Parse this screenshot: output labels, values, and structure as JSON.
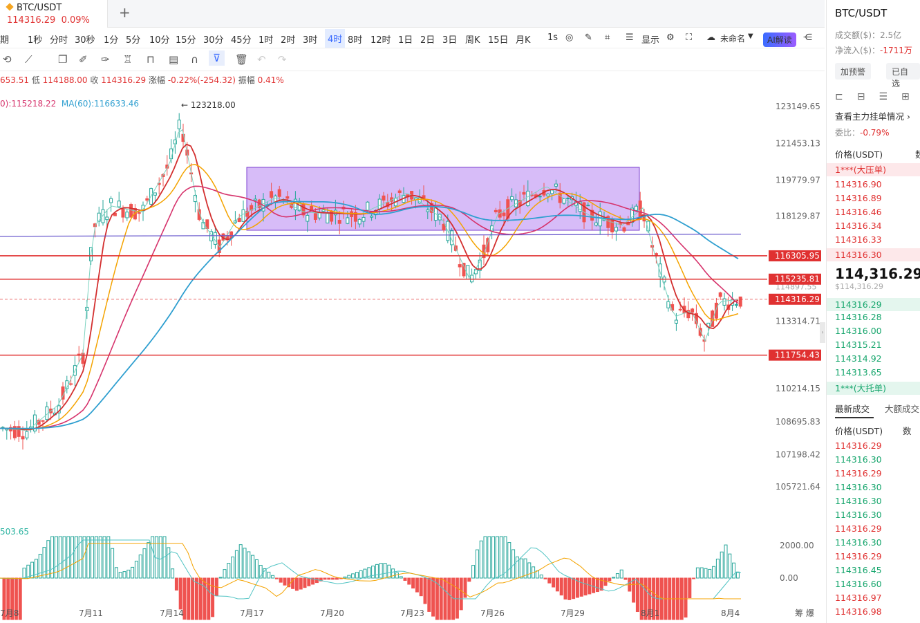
{
  "tab": {
    "symbol": "BTC/USDT",
    "price": "114316.29",
    "change": "0.09%"
  },
  "intervals": [
    "期",
    "1秒",
    "分时",
    "30秒",
    "1分",
    "5分",
    "10分",
    "15分",
    "30分",
    "45分",
    "1时",
    "2时",
    "3时",
    "4时",
    "8时",
    "12时",
    "1日",
    "2日",
    "3日",
    "周K",
    "15日",
    "月K",
    "1s"
  ],
  "active_interval": "4时",
  "toolbar1_extra": {
    "display": "显示",
    "unnamed": "未命名",
    "ai": "AI解读"
  },
  "ohlc": {
    "open": "653.51",
    "low_label": "低",
    "low": "114188.00",
    "close_label": "收",
    "close": "114316.29",
    "chg_label": "涨幅",
    "chg": "-0.22%(-254.32)",
    "amp_label": "振幅",
    "amp": "0.41%"
  },
  "ma": {
    "ma30": "0):115218.22",
    "ma60": "MA(60):116633.46"
  },
  "macd_value": "503.65",
  "high_marker": "123218.00",
  "price_axis": [
    "123149.65",
    "121453.13",
    "119779.97",
    "118129.87",
    "113314.71",
    "110214.15",
    "108695.83",
    "107198.42",
    "105721.64"
  ],
  "level_lines": [
    {
      "value": 116305.95,
      "label": "116305.95"
    },
    {
      "value": 115235.81,
      "label": "115235.81"
    },
    {
      "value": 111754.43,
      "label": "111754.43"
    }
  ],
  "current_label": "114316.29",
  "hidden_label": "114897.55",
  "macd_axis": [
    "2000.00",
    "0.00"
  ],
  "date_axis": [
    "7月8",
    "7月11",
    "7月14",
    "7月17",
    "7月20",
    "7月23",
    "7月26",
    "7月29",
    "8月1",
    "8月4"
  ],
  "bottom_right": "筹 爆",
  "panel": {
    "title": "BTC/USDT",
    "volume": "成交额($)：2.5亿",
    "netflow_label": "净流入($)：",
    "netflow": "-1711万",
    "btn_alert": "加预警",
    "btn_fav": "已自选",
    "orderbook_link": "查看主力挂单情况",
    "ratio_label": "委比：",
    "ratio": "-0.79%",
    "price_header": "价格(USDT)",
    "qty_header": "数",
    "ask_big": "1***(大压单)",
    "asks": [
      "114316.90",
      "114316.89",
      "114316.46",
      "114316.34",
      "114316.33",
      "114316.30"
    ],
    "last": "114,316.29",
    "last_usd": "$114,316.29",
    "bids": [
      "114316.29",
      "114316.28",
      "114316.00",
      "114315.21",
      "114314.92",
      "114313.65"
    ],
    "bid_big": "1***(大托单)",
    "trades_tab": "最新成交",
    "big_trades_tab": "大额成交",
    "trades": [
      {
        "p": "114316.29",
        "c": "red"
      },
      {
        "p": "114316.30",
        "c": "green"
      },
      {
        "p": "114316.29",
        "c": "red"
      },
      {
        "p": "114316.30",
        "c": "green"
      },
      {
        "p": "114316.30",
        "c": "green"
      },
      {
        "p": "114316.30",
        "c": "green"
      },
      {
        "p": "114316.29",
        "c": "red"
      },
      {
        "p": "114316.30",
        "c": "green"
      },
      {
        "p": "114316.29",
        "c": "red"
      },
      {
        "p": "114316.45",
        "c": "green"
      },
      {
        "p": "114316.60",
        "c": "green"
      },
      {
        "p": "114316.97",
        "c": "red"
      },
      {
        "p": "114316.98",
        "c": "red"
      }
    ]
  }
}
